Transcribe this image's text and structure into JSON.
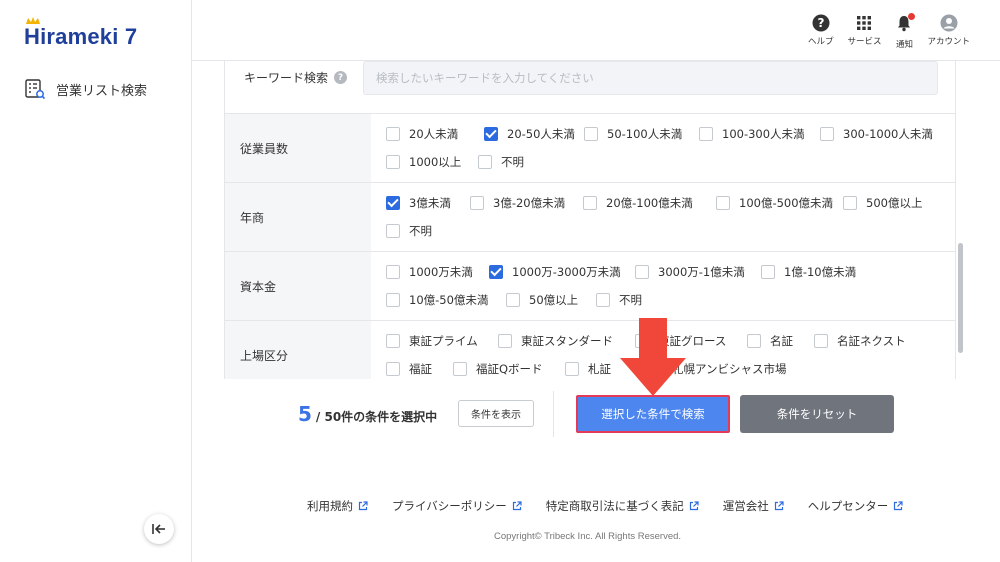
{
  "brand": {
    "logo_text": "Hirameki 7"
  },
  "sidebar": {
    "nav_item": "営業リスト検索"
  },
  "header": {
    "help": "ヘルプ",
    "services": "サービス",
    "notifications": "通知",
    "account": "アカウント"
  },
  "keyword": {
    "label": "キーワード検索",
    "placeholder": "検索したいキーワードを入力してください"
  },
  "filters": [
    {
      "label": "従業員数",
      "options": [
        {
          "label": "20人未満",
          "checked": false
        },
        {
          "label": "20-50人未満",
          "checked": true
        },
        {
          "label": "50-100人未満",
          "checked": false
        },
        {
          "label": "100-300人未満",
          "checked": false
        },
        {
          "label": "300-1000人未満",
          "checked": false
        },
        {
          "label": "1000以上",
          "checked": false
        },
        {
          "label": "不明",
          "checked": false
        }
      ]
    },
    {
      "label": "年商",
      "options": [
        {
          "label": "3億未満",
          "checked": true
        },
        {
          "label": "3億-20億未満",
          "checked": false
        },
        {
          "label": "20億-100億未満",
          "checked": false
        },
        {
          "label": "100億-500億未満",
          "checked": false
        },
        {
          "label": "500億以上",
          "checked": false
        },
        {
          "label": "不明",
          "checked": false
        }
      ]
    },
    {
      "label": "資本金",
      "options": [
        {
          "label": "1000万未満",
          "checked": false
        },
        {
          "label": "1000万-3000万未満",
          "checked": true
        },
        {
          "label": "3000万-1億未満",
          "checked": false
        },
        {
          "label": "1億-10億未満",
          "checked": false
        },
        {
          "label": "10億-50億未満",
          "checked": false
        },
        {
          "label": "50億以上",
          "checked": false
        },
        {
          "label": "不明",
          "checked": false
        }
      ]
    },
    {
      "label": "上場区分",
      "options": [
        {
          "label": "東証プライム",
          "checked": false
        },
        {
          "label": "東証スタンダード",
          "checked": false
        },
        {
          "label": "東証グロース",
          "checked": false
        },
        {
          "label": "名証",
          "checked": false
        },
        {
          "label": "名証ネクスト",
          "checked": false
        },
        {
          "label": "福証",
          "checked": false
        },
        {
          "label": "福証Qボード",
          "checked": false
        },
        {
          "label": "札証",
          "checked": false
        },
        {
          "label": "札幌アンビシャス市場",
          "checked": false
        }
      ]
    }
  ],
  "actions": {
    "selected_count": "5",
    "count_text": "/ 50件の条件を選択中",
    "show_conditions": "条件を表示",
    "search": "選択した条件で検索",
    "reset": "条件をリセット"
  },
  "footer": {
    "links": [
      "利用規約",
      "プライバシーポリシー",
      "特定商取引法に基づく表記",
      "運営会社",
      "ヘルプセンター"
    ],
    "copyright": "Copyright© Tribeck Inc. All Rights Reserved."
  },
  "colors": {
    "brand": "#1f3f9a",
    "primary": "#4d86ee",
    "highlight_border": "#e23a57",
    "reset": "#70747c",
    "arrow": "#f0473a"
  }
}
